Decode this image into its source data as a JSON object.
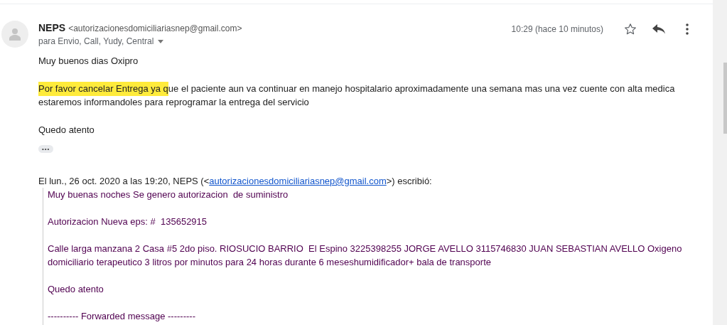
{
  "sender": {
    "name": "NEPS",
    "address": "<autorizacionesdomiciliariasnep@gmail.com>"
  },
  "recipients": "para Envio, Call, Yudy, Central",
  "time": "10:29 (hace 10 minutos)",
  "starred": false,
  "greeting": "Muy buenos dias Oxipro",
  "paragraphs": [
    {
      "highlighted": "Por favor cancelar Entrega ya q",
      "text": "ue el paciente aun va continuar en manejo hospitalario aproximadamente una semana mas una vez cuente con alta medica estaremos informandoles para reprogramar la entrega del servicio"
    }
  ],
  "closing": "Quedo atento",
  "trimmed_content": "•••",
  "quote": {
    "attribution_before": "El lun., 26 oct. 2020 a las 19:20, NEPS (<",
    "link": "autorizacionesdomiciliariasnep@gmail.com",
    "attribution_after": ">) escribió:",
    "paragraphs": [
      "Muy buenas noches Se genero autorizacion  de suministro",
      "Autorizacion Nueva eps: #  135652915",
      "Calle larga manzana 2 Casa #5 2do piso. RIOSUCIO BARRIO  El Espino 3225398255 JORGE AVELLO 3115746830 JUAN SEBASTIAN AVELLO Oxigeno domiciliario terapeutico 3 litros por minutos para 24 horas durante 6 meseshumidificador+ bala de transporte",
      "Quedo atento",
      "---------- Forwarded message ---------"
    ]
  }
}
